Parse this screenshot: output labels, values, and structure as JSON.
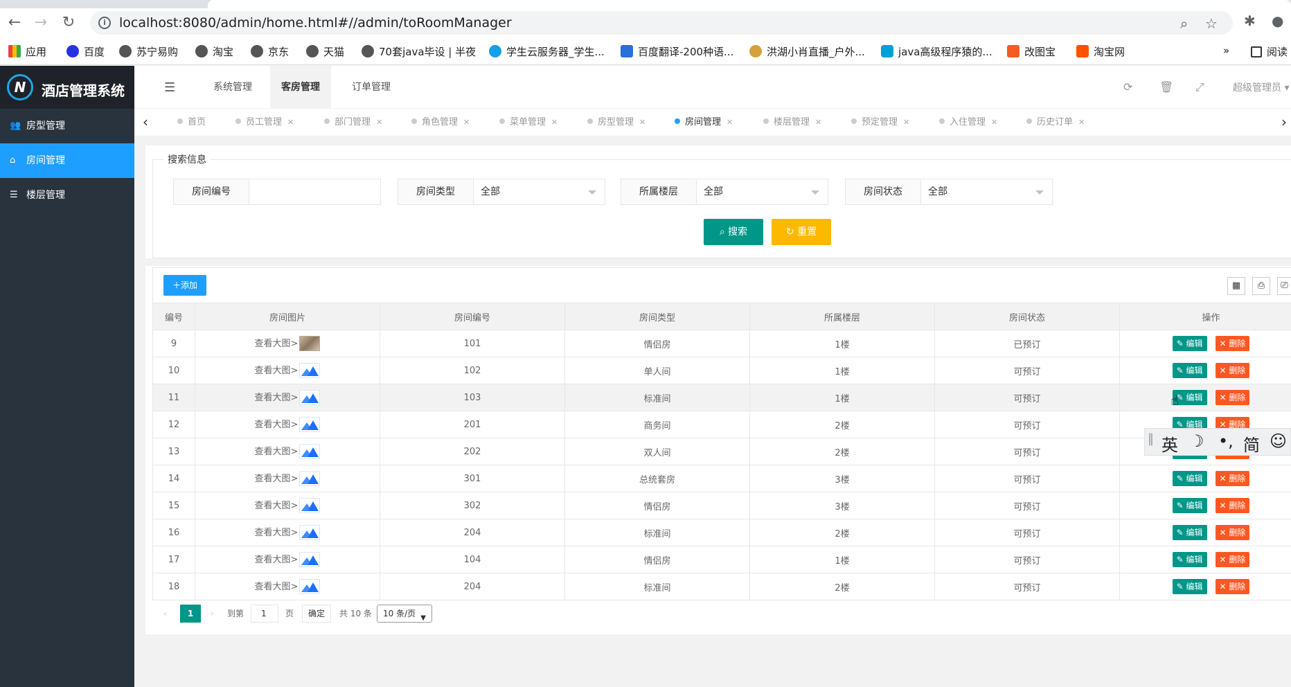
{
  "browser": {
    "url": "localhost:8080/admin/home.html#//admin/toRoomManager",
    "bookmarks": [
      "应用",
      "百度",
      "苏宁易购",
      "淘宝",
      "京东",
      "天猫",
      "70套java毕设 | 半夜",
      "学生云服务器_学生...",
      "百度翻译-200种语...",
      "洪湖小肖直播_户外...",
      "java高级程序猿的...",
      "改图宝",
      "淘宝网",
      "阅读"
    ],
    "more": "»"
  },
  "app": {
    "logo_letter": "N",
    "title": "酒店管理系统",
    "top_menu": [
      "系统管理",
      "客房管理",
      "订单管理"
    ],
    "admin": "超级管理员"
  },
  "sidebar": {
    "items": [
      {
        "label": "房型管理",
        "icon": "users-icon",
        "active": false
      },
      {
        "label": "房间管理",
        "icon": "home-icon",
        "active": true
      },
      {
        "label": "楼层管理",
        "icon": "list-icon",
        "active": false
      }
    ]
  },
  "page_tabs": [
    "首页",
    "员工管理",
    "部门管理",
    "角色管理",
    "菜单管理",
    "房型管理",
    "房间管理",
    "楼层管理",
    "预定管理",
    "入住管理",
    "历史订单"
  ],
  "search": {
    "legend": "搜索信息",
    "fields": [
      {
        "label": "房间编号",
        "value": ""
      },
      {
        "label": "房间类型",
        "value": "全部"
      },
      {
        "label": "所属楼层",
        "value": "全部"
      },
      {
        "label": "房间状态",
        "value": "全部"
      }
    ],
    "search_btn": "搜索",
    "reset_btn": "重置"
  },
  "table": {
    "add_btn": "添加",
    "columns": [
      "编号",
      "房间图片",
      "房间编号",
      "房间类型",
      "所属楼层",
      "房间状态",
      "操作"
    ],
    "view_text": "查看大图>",
    "edit_btn": "编辑",
    "delete_btn": "删除",
    "rows": [
      {
        "id": "9",
        "room": "101",
        "type": "情侣房",
        "floor": "1楼",
        "status": "已预订",
        "green": false,
        "photo": true
      },
      {
        "id": "10",
        "room": "102",
        "type": "单人间",
        "floor": "1楼",
        "status": "可预订",
        "green": true,
        "photo": false
      },
      {
        "id": "11",
        "room": "103",
        "type": "标准间",
        "floor": "1楼",
        "status": "可预订",
        "green": true,
        "photo": false
      },
      {
        "id": "12",
        "room": "201",
        "type": "商务间",
        "floor": "2楼",
        "status": "可预订",
        "green": true,
        "photo": false
      },
      {
        "id": "13",
        "room": "202",
        "type": "双人间",
        "floor": "2楼",
        "status": "可预订",
        "green": true,
        "photo": false
      },
      {
        "id": "14",
        "room": "301",
        "type": "总统套房",
        "floor": "3楼",
        "status": "可预订",
        "green": true,
        "photo": false
      },
      {
        "id": "15",
        "room": "302",
        "type": "情侣房",
        "floor": "3楼",
        "status": "可预订",
        "green": true,
        "photo": false
      },
      {
        "id": "16",
        "room": "204",
        "type": "标准间",
        "floor": "2楼",
        "status": "可预订",
        "green": true,
        "photo": false
      },
      {
        "id": "17",
        "room": "104",
        "type": "情侣房",
        "floor": "1楼",
        "status": "可预订",
        "green": true,
        "photo": false
      },
      {
        "id": "18",
        "room": "204",
        "type": "标准间",
        "floor": "2楼",
        "status": "可预订",
        "green": true,
        "photo": false
      }
    ]
  },
  "pager": {
    "current": "1",
    "goto_label": "到第",
    "goto_value": "1",
    "page_unit": "页",
    "confirm": "确定",
    "total": "共 10 条",
    "page_size": "10 条/页"
  },
  "ime": [
    "英",
    "☽",
    "•,",
    "简",
    "☺"
  ],
  "colors": {
    "sidebar": "#28333e",
    "active": "#1e9fff",
    "teal": "#009688",
    "orange": "#ffb800",
    "red": "#ff5722"
  }
}
